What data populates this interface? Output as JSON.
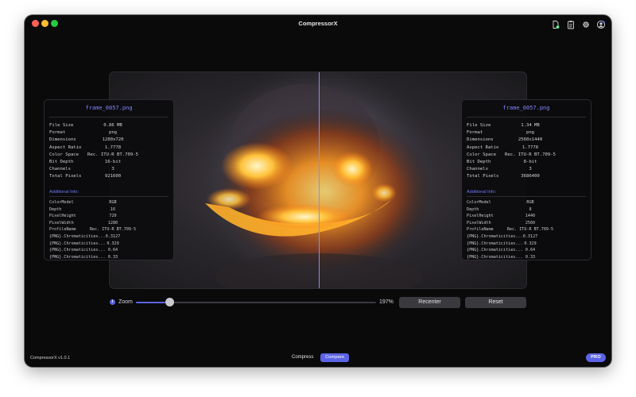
{
  "window": {
    "title": "CompressorX"
  },
  "toolbar": {
    "icons": [
      "export-file-icon",
      "clipboard-icon",
      "gear-icon",
      "account-icon"
    ]
  },
  "left_panel": {
    "filename": "frame_0057.png",
    "rows": [
      {
        "key": "File Size",
        "value": "0.86 MB"
      },
      {
        "key": "Format",
        "value": "png"
      },
      {
        "key": "Dimensions",
        "value": "1280x720"
      },
      {
        "key": "Aspect Ratio",
        "value": "1.7778"
      },
      {
        "key": "Color Space",
        "value": "Rec. ITU-R BT.709-5"
      },
      {
        "key": "Bit Depth",
        "value": "16-bit"
      },
      {
        "key": "Channels",
        "value": "3"
      },
      {
        "key": "Total Pixels",
        "value": "921600"
      }
    ],
    "additional_label": "Additional Info:",
    "additional": [
      {
        "key": "ColorModel",
        "value": "RGB"
      },
      {
        "key": "Depth",
        "value": "16"
      },
      {
        "key": "PixelHeight",
        "value": "720"
      },
      {
        "key": "PixelWidth",
        "value": "1280"
      },
      {
        "key": "ProfileName",
        "value": "Rec. ITU-R BT.709-5"
      },
      {
        "key": "{PNG}.Chromaticities...",
        "value": "0.3127"
      },
      {
        "key": "{PNG}.Chromaticities...",
        "value": "0.329"
      },
      {
        "key": "{PNG}.Chromaticities...",
        "value": "0.64"
      },
      {
        "key": "{PNG}.Chromaticities...",
        "value": "0.33"
      }
    ]
  },
  "right_panel": {
    "filename": "frame_0057.png",
    "rows": [
      {
        "key": "File Size",
        "value": "1.34 MB"
      },
      {
        "key": "Format",
        "value": "png"
      },
      {
        "key": "Dimensions",
        "value": "2560x1440"
      },
      {
        "key": "Aspect Ratio",
        "value": "1.7778"
      },
      {
        "key": "Color Space",
        "value": "Rec. ITU-R BT.709-5"
      },
      {
        "key": "Bit Depth",
        "value": "8-bit"
      },
      {
        "key": "Channels",
        "value": "3"
      },
      {
        "key": "Total Pixels",
        "value": "3686400"
      }
    ],
    "additional_label": "Additional Info:",
    "additional": [
      {
        "key": "ColorModel",
        "value": "RGB"
      },
      {
        "key": "Depth",
        "value": "8"
      },
      {
        "key": "PixelHeight",
        "value": "1440"
      },
      {
        "key": "PixelWidth",
        "value": "2560"
      },
      {
        "key": "ProfileName",
        "value": "Rec. ITU-R BT.709-5"
      },
      {
        "key": "{PNG}.Chromaticities...",
        "value": "0.3127"
      },
      {
        "key": "{PNG}.Chromaticities...",
        "value": "0.329"
      },
      {
        "key": "{PNG}.Chromaticities...",
        "value": "0.64"
      },
      {
        "key": "{PNG}.Chromaticities...",
        "value": "0.33"
      }
    ]
  },
  "zoom": {
    "label": "Zoom",
    "value_text": "197%",
    "slider_fraction": 0.14,
    "info_glyph": "i"
  },
  "buttons": {
    "recenter": "Recenter",
    "reset": "Reset"
  },
  "footer": {
    "version": "CompressorX v1.0.1",
    "tab_compress": "Compress",
    "tab_compare": "Compare",
    "pro": "PRO"
  },
  "colors": {
    "accent": "#5c64e6",
    "panel_title": "#7f86ff",
    "window_bg": "#0a0a0b",
    "button_bg": "#3a3a3e"
  }
}
